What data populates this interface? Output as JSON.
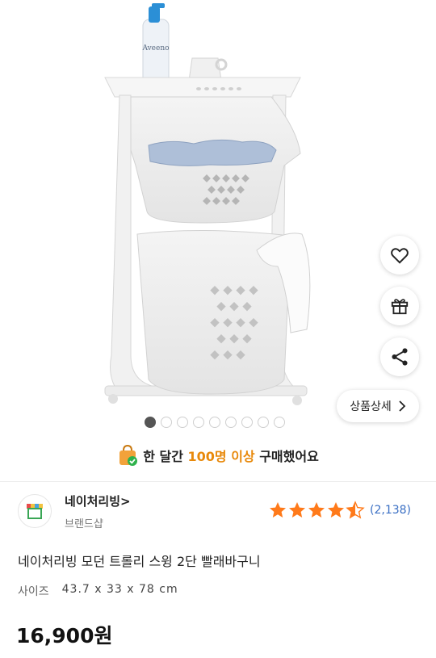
{
  "product_image": {
    "alt": "laundry basket trolley",
    "label_text": "Aveeno"
  },
  "side_actions": [
    {
      "name": "wishlist",
      "icon": "heart-icon"
    },
    {
      "name": "gift",
      "icon": "gift-icon"
    },
    {
      "name": "share",
      "icon": "share-icon"
    }
  ],
  "detail_button": {
    "label": "상품상세",
    "icon": "chevron-right-icon"
  },
  "carousel": {
    "total": 9,
    "active": 1
  },
  "purchase_banner": {
    "prefix": "한 달간 ",
    "highlight": "100명 이상",
    "suffix": " 구매했어요"
  },
  "brand": {
    "name": "네이처리빙",
    "arrow": ">",
    "subtitle": "브랜드샵"
  },
  "rating": {
    "stars": 4.5,
    "count": "(2,138)"
  },
  "product": {
    "title": "네이처리빙 모던 트롤리 스윙 2단 빨래바구니",
    "size_label": "사이즈",
    "size_value": "43.7 x 33 x 78 cm",
    "price": "16,900원"
  },
  "colors": {
    "star": "#ff7a1a",
    "link": "#3a6fc4",
    "highlight": "#e8890b"
  }
}
